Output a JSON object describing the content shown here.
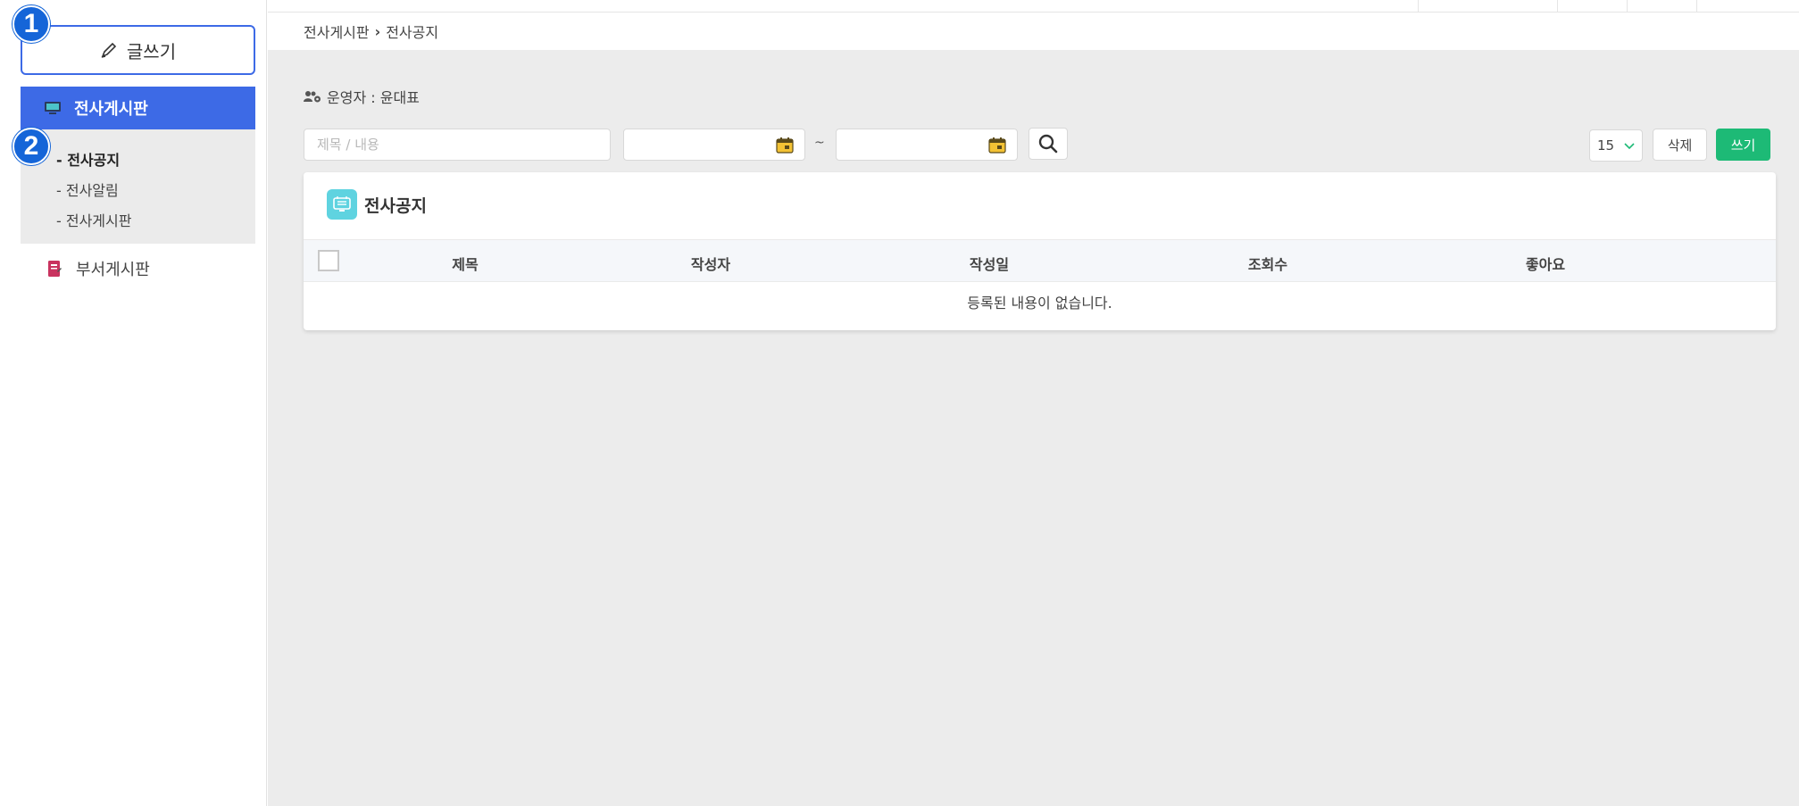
{
  "sidebar": {
    "write_label": "글쓰기",
    "badge_1": "1",
    "badge_2": "2",
    "company_board_label": "전사게시판",
    "sub_items": [
      "- 전사공지",
      "- 전사알림",
      "- 전사게시판"
    ],
    "dept_board_label": "부서게시판"
  },
  "breadcrumb": {
    "parent": "전사게시판",
    "separator": "›",
    "current": "전사공지"
  },
  "operator": {
    "text": "운영자 : 윤대표"
  },
  "filters": {
    "search_placeholder": "제목 / 내용",
    "date_from": "",
    "date_to": "",
    "tilde": "~",
    "page_size": "15"
  },
  "actions": {
    "delete_label": "삭제",
    "write_label": "쓰기"
  },
  "table": {
    "title": "전사공지",
    "columns": [
      "제목",
      "작성자",
      "작성일",
      "조회수",
      "좋아요"
    ],
    "empty_message": "등록된 내용이 없습니다."
  },
  "colors": {
    "accent_blue": "#3d6ae6",
    "badge_blue": "#1565d8",
    "write_green": "#1dba76",
    "card_icon_cyan": "#5fd3e0"
  }
}
